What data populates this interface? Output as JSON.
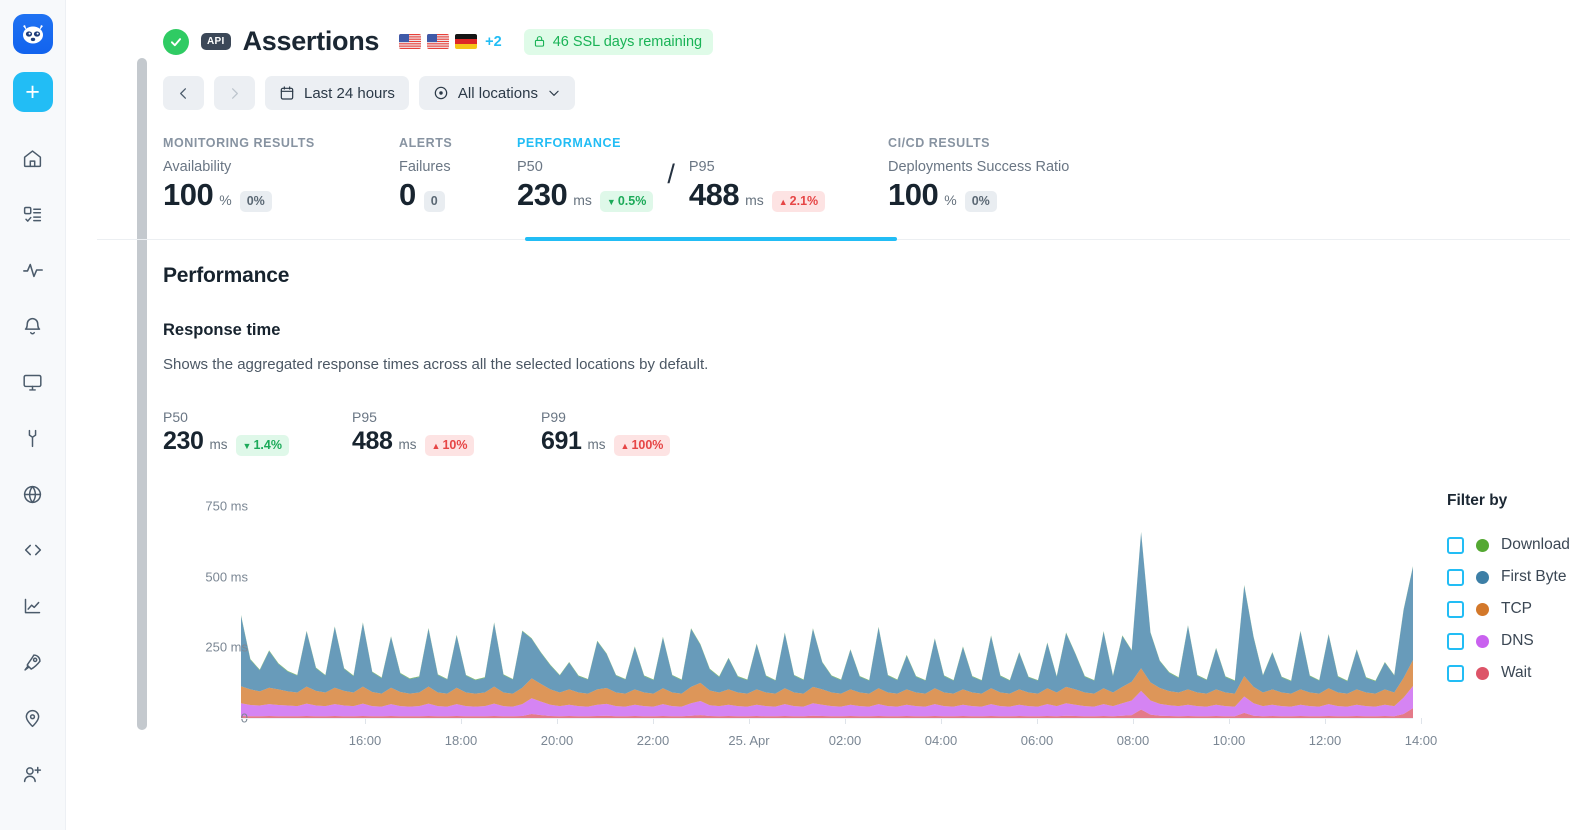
{
  "sidebar": {
    "logo_name": "raccoon-logo",
    "add_button_label": "+",
    "items": [
      {
        "name": "home-icon",
        "label": "Home"
      },
      {
        "name": "checklist-icon",
        "label": "Checks"
      },
      {
        "name": "pulse-icon",
        "label": "Monitoring"
      },
      {
        "name": "bell-icon",
        "label": "Alerts"
      },
      {
        "name": "monitor-icon",
        "label": "Dashboards"
      },
      {
        "name": "wrench-icon",
        "label": "Maintenance"
      },
      {
        "name": "globe-icon",
        "label": "Locations"
      },
      {
        "name": "code-icon",
        "label": "Code"
      },
      {
        "name": "chart-icon",
        "label": "Analytics"
      },
      {
        "name": "rocket-icon",
        "label": "Deployments"
      },
      {
        "name": "pin-icon",
        "label": "Private locations"
      },
      {
        "name": "add-user-icon",
        "label": "Invite user"
      }
    ]
  },
  "header": {
    "title": "Assertions",
    "api_badge": "API",
    "status": "passing",
    "flags": [
      "US",
      "US",
      "DE"
    ],
    "flags_more": "+2",
    "ssl_badge": "46 SSL days remaining"
  },
  "toolbar": {
    "prev_label": "‹",
    "next_label": "›",
    "date_range": "Last 24 hours",
    "locations": "All locations"
  },
  "stats": {
    "groups": [
      {
        "label": "MONITORING RESULTS",
        "active": false,
        "metrics": [
          {
            "sub": "Availability",
            "value": "100",
            "unit": "%",
            "chip": "0%",
            "chip_type": "grey"
          }
        ]
      },
      {
        "label": "ALERTS",
        "active": false,
        "metrics": [
          {
            "sub": "Failures",
            "value": "0",
            "unit": "",
            "chip": "0",
            "chip_type": "grey"
          }
        ]
      },
      {
        "label": "PERFORMANCE",
        "active": true,
        "metrics": [
          {
            "sub": "P50",
            "value": "230",
            "unit": "ms",
            "chip": "0.5%",
            "chip_type": "green",
            "arrow": "down"
          },
          {
            "sub": "P95",
            "value": "488",
            "unit": "ms",
            "chip": "2.1%",
            "chip_type": "red",
            "arrow": "up"
          }
        ],
        "separator": "/"
      },
      {
        "label": "CI/CD RESULTS",
        "active": false,
        "metrics": [
          {
            "sub": "Deployments Success Ratio",
            "value": "100",
            "unit": "%",
            "chip": "0%",
            "chip_type": "grey"
          }
        ]
      }
    ]
  },
  "content": {
    "section_title": "Performance",
    "subsection_title": "Response time",
    "description": "Shows the aggregated response times across all the selected locations by default.",
    "percentiles": [
      {
        "label": "P50",
        "value": "230",
        "unit": "ms",
        "chip": "1.4%",
        "chip_type": "green",
        "arrow": "down"
      },
      {
        "label": "P95",
        "value": "488",
        "unit": "ms",
        "chip": "10%",
        "chip_type": "red",
        "arrow": "up"
      },
      {
        "label": "P99",
        "value": "691",
        "unit": "ms",
        "chip": "100%",
        "chip_type": "red",
        "arrow": "up"
      }
    ]
  },
  "filter": {
    "title": "Filter by",
    "items": [
      {
        "label": "Download",
        "color": "#54a832",
        "checked": false
      },
      {
        "label": "First Byte",
        "color": "#3d7fa6",
        "checked": false
      },
      {
        "label": "TCP",
        "color": "#d3782a",
        "checked": false
      },
      {
        "label": "DNS",
        "color": "#c961ef",
        "checked": false
      },
      {
        "label": "Wait",
        "color": "#dd5468",
        "checked": false
      }
    ]
  },
  "chart_data": {
    "type": "area",
    "stacked": true,
    "title": "Response time",
    "xlabel": "",
    "ylabel": "ms",
    "ylim": [
      0,
      820
    ],
    "yticks": [
      0,
      250,
      500,
      750
    ],
    "ytick_labels": [
      "0",
      "250 ms",
      "500 ms",
      "750 ms"
    ],
    "grid": false,
    "legend_position": "right",
    "xtick_labels": [
      "16:00",
      "18:00",
      "20:00",
      "22:00",
      "25. Apr",
      "02:00",
      "04:00",
      "06:00",
      "08:00",
      "10:00",
      "12:00",
      "14:00"
    ],
    "xtick_positions": [
      202,
      298,
      394,
      490,
      586,
      682,
      778,
      874,
      970,
      1066,
      1162,
      1258
    ],
    "series": [
      {
        "name": "Wait",
        "color": "#dd5468",
        "values": [
          7,
          6,
          6,
          7,
          6,
          6,
          6,
          7,
          6,
          6,
          7,
          6,
          6,
          7,
          6,
          6,
          7,
          6,
          6,
          6,
          7,
          6,
          6,
          7,
          6,
          6,
          6,
          7,
          6,
          6,
          7,
          14,
          10,
          7,
          6,
          7,
          6,
          6,
          7,
          8,
          6,
          6,
          7,
          6,
          6,
          7,
          6,
          6,
          8,
          10,
          7,
          6,
          7,
          6,
          6,
          7,
          6,
          6,
          7,
          6,
          6,
          8,
          7,
          6,
          6,
          7,
          6,
          6,
          7,
          6,
          6,
          7,
          6,
          6,
          7,
          6,
          6,
          7,
          6,
          6,
          7,
          6,
          6,
          7,
          6,
          6,
          7,
          6,
          8,
          7,
          6,
          6,
          7,
          6,
          8,
          10,
          30,
          12,
          8,
          7,
          6,
          7,
          6,
          6,
          7,
          6,
          6,
          18,
          8,
          6,
          7,
          6,
          6,
          7,
          6,
          6,
          7,
          6,
          6,
          7,
          6,
          6,
          7,
          6,
          14,
          35
        ]
      },
      {
        "name": "DNS",
        "color": "#c961ef",
        "values": [
          45,
          40,
          38,
          42,
          40,
          38,
          36,
          44,
          38,
          36,
          42,
          38,
          36,
          44,
          36,
          34,
          42,
          36,
          34,
          36,
          44,
          36,
          34,
          42,
          36,
          34,
          36,
          44,
          36,
          34,
          42,
          56,
          48,
          40,
          36,
          40,
          36,
          34,
          40,
          42,
          36,
          34,
          40,
          36,
          34,
          42,
          36,
          34,
          44,
          50,
          38,
          36,
          40,
          36,
          34,
          40,
          36,
          34,
          42,
          36,
          34,
          44,
          40,
          36,
          34,
          40,
          36,
          34,
          42,
          36,
          34,
          40,
          36,
          34,
          42,
          36,
          34,
          40,
          36,
          34,
          42,
          36,
          34,
          40,
          36,
          34,
          42,
          36,
          44,
          40,
          36,
          34,
          42,
          36,
          44,
          52,
          66,
          50,
          42,
          38,
          36,
          40,
          36,
          34,
          40,
          36,
          34,
          58,
          44,
          36,
          40,
          36,
          34,
          40,
          36,
          34,
          42,
          36,
          34,
          40,
          36,
          34,
          40,
          36,
          58,
          78
        ]
      },
      {
        "name": "TCP",
        "color": "#d3782a",
        "values": [
          60,
          55,
          50,
          58,
          55,
          50,
          48,
          60,
          52,
          48,
          58,
          52,
          48,
          60,
          50,
          46,
          58,
          50,
          46,
          48,
          60,
          48,
          46,
          58,
          48,
          46,
          48,
          60,
          48,
          46,
          58,
          70,
          62,
          54,
          48,
          54,
          48,
          46,
          54,
          56,
          48,
          46,
          54,
          48,
          46,
          56,
          48,
          46,
          58,
          64,
          52,
          48,
          54,
          48,
          46,
          54,
          48,
          46,
          56,
          48,
          46,
          58,
          54,
          48,
          46,
          54,
          48,
          46,
          56,
          48,
          46,
          54,
          48,
          46,
          56,
          48,
          46,
          54,
          48,
          46,
          56,
          48,
          46,
          54,
          48,
          46,
          56,
          48,
          58,
          54,
          48,
          46,
          56,
          48,
          58,
          66,
          80,
          64,
          56,
          50,
          48,
          54,
          48,
          46,
          54,
          48,
          46,
          72,
          58,
          48,
          54,
          48,
          46,
          54,
          48,
          46,
          56,
          48,
          46,
          54,
          48,
          46,
          54,
          48,
          70,
          92
        ]
      },
      {
        "name": "First Byte",
        "color": "#3d7fa6",
        "values": [
          250,
          105,
          75,
          130,
          90,
          70,
          60,
          195,
          80,
          60,
          215,
          78,
          58,
          225,
          70,
          55,
          180,
          65,
          52,
          55,
          205,
          62,
          50,
          185,
          60,
          48,
          52,
          225,
          62,
          50,
          200,
          140,
          110,
          85,
          60,
          95,
          58,
          50,
          170,
          120,
          60,
          50,
          150,
          58,
          48,
          180,
          60,
          48,
          205,
          135,
          75,
          55,
          110,
          56,
          48,
          160,
          58,
          46,
          195,
          60,
          48,
          205,
          95,
          58,
          48,
          140,
          56,
          46,
          215,
          60,
          48,
          120,
          56,
          46,
          175,
          58,
          46,
          150,
          56,
          46,
          185,
          58,
          46,
          130,
          54,
          46,
          160,
          56,
          190,
          125,
          56,
          46,
          200,
          58,
          180,
          110,
          480,
          175,
          95,
          65,
          52,
          225,
          60,
          48,
          145,
          55,
          45,
          320,
          175,
          60,
          130,
          54,
          44,
          205,
          58,
          46,
          190,
          56,
          44,
          140,
          52,
          44,
          95,
          60,
          240,
          330
        ]
      },
      {
        "name": "Download",
        "color": "#54a832",
        "values": [
          2,
          2,
          2,
          2,
          2,
          2,
          2,
          2,
          2,
          2,
          2,
          2,
          2,
          2,
          2,
          2,
          2,
          2,
          2,
          2,
          2,
          2,
          2,
          2,
          2,
          2,
          2,
          2,
          2,
          2,
          2,
          2,
          2,
          2,
          2,
          2,
          2,
          2,
          2,
          2,
          2,
          2,
          2,
          2,
          2,
          2,
          2,
          2,
          2,
          2,
          2,
          2,
          2,
          2,
          2,
          2,
          2,
          2,
          2,
          2,
          2,
          2,
          2,
          2,
          2,
          2,
          2,
          2,
          2,
          2,
          2,
          2,
          2,
          2,
          2,
          2,
          2,
          2,
          2,
          2,
          2,
          2,
          2,
          2,
          2,
          2,
          2,
          2,
          2,
          2,
          2,
          2,
          2,
          2,
          2,
          2,
          2,
          2,
          2,
          2,
          2,
          2,
          2,
          2,
          2,
          2,
          2,
          2,
          2,
          2,
          2,
          2,
          2,
          2,
          2,
          2,
          2,
          2,
          2,
          2,
          2,
          2,
          2,
          2,
          2,
          2
        ]
      }
    ]
  }
}
